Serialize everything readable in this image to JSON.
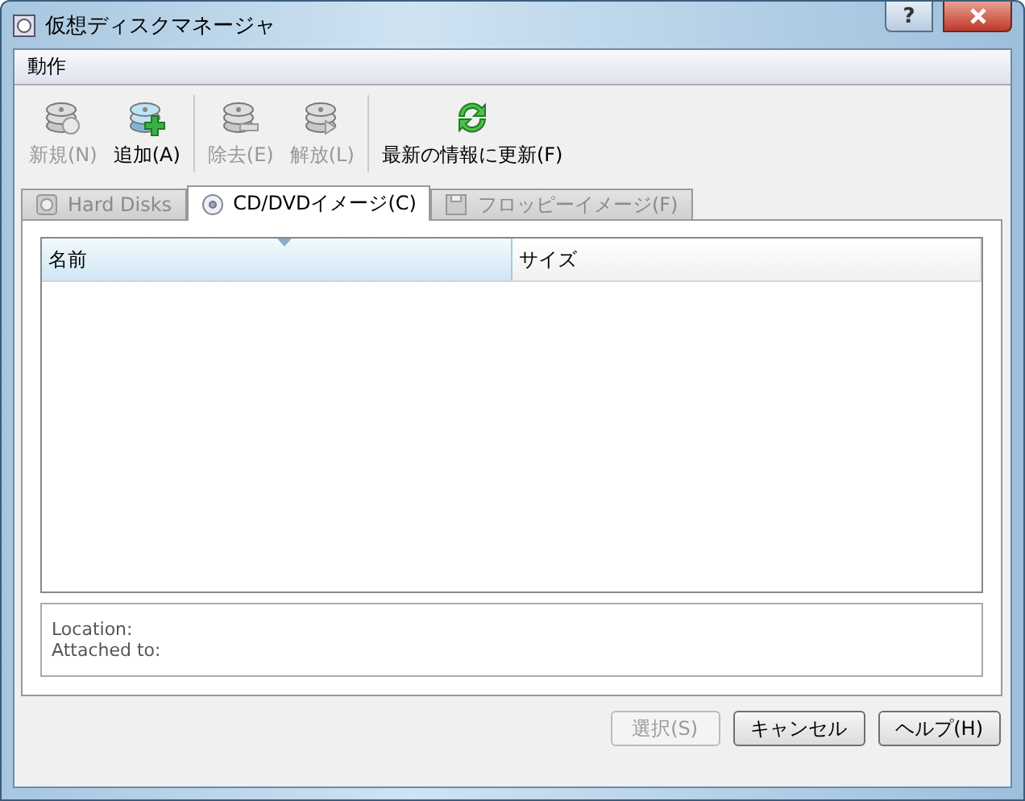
{
  "window": {
    "title": "仮想ディスクマネージャ",
    "help_button": "?"
  },
  "menu": [
    "動作"
  ],
  "toolbar": [
    [
      {
        "label": "新規(N)",
        "kind": "new",
        "disabled": true
      },
      {
        "label": "追加(A)",
        "kind": "add",
        "disabled": false
      }
    ],
    [
      {
        "label": "除去(E)",
        "kind": "remove",
        "disabled": true
      },
      {
        "label": "解放(L)",
        "kind": "release",
        "disabled": true
      }
    ],
    [
      {
        "label": "最新の情報に更新(F)",
        "kind": "refresh",
        "disabled": false
      }
    ]
  ],
  "tabs": [
    {
      "label": "Hard Disks",
      "kind": "hdd",
      "selected": false,
      "disabled": true
    },
    {
      "label": "CD/DVDイメージ(C)",
      "kind": "cd",
      "selected": true,
      "disabled": false
    },
    {
      "label": "フロッピーイメージ(F)",
      "kind": "floppy",
      "selected": false,
      "disabled": true
    }
  ],
  "table": {
    "columns": [
      {
        "label": "名前",
        "sorted": true
      },
      {
        "label": "サイズ",
        "sorted": false
      }
    ]
  },
  "details": [
    "Location:",
    "Attached to:"
  ],
  "buttons": [
    {
      "label": "選択(S)",
      "disabled": true
    },
    {
      "label": "キャンセル",
      "disabled": false
    },
    {
      "label": "ヘルプ(H)",
      "disabled": false
    }
  ]
}
